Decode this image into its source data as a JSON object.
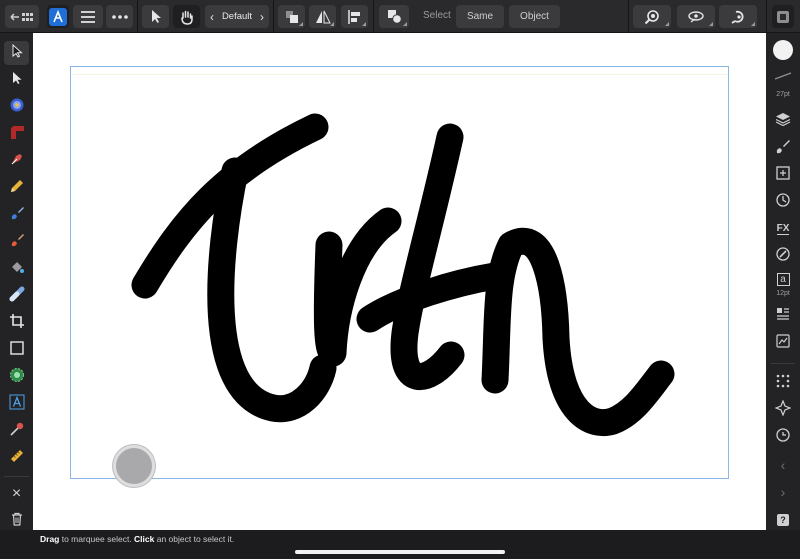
{
  "toolbar": {
    "history_icon": "back-grid-icon",
    "app_icon": "affinity-designer-icon",
    "menu_icon": "hamburger-icon",
    "more_icon": "more-icon",
    "move_icon": "move-tool-icon",
    "hand_icon": "hand-tool-icon",
    "style_prev": "‹",
    "style_name": "Default",
    "style_next": "›",
    "arrange_icon": "arrange-icon",
    "flip_icon": "flip-icon",
    "align_icon": "align-icon",
    "boolean_icon": "boolean-icon",
    "select_label": "Select",
    "same_label": "Same",
    "object_label": "Object",
    "snapping_icon": "snapping-icon",
    "view_icon": "view-quality-icon",
    "assistant_icon": "assistant-icon",
    "export_icon": "export-persona-icon"
  },
  "left_tools": [
    "move-tool-icon",
    "node-tool-icon",
    "gradient-spiral-icon",
    "corner-tool-icon",
    "pen-tool-icon",
    "pencil-tool-icon",
    "vector-brush-icon",
    "pixel-brush-icon",
    "fill-tool-icon",
    "transparency-tool-icon",
    "crop-tool-icon",
    "rectangle-tool-icon",
    "place-image-icon",
    "text-tool-icon",
    "color-picker-icon",
    "measure-tool-icon"
  ],
  "left_bottom": {
    "close_label": "×",
    "delete_icon": "trash-icon"
  },
  "right_panel": {
    "stroke_size": "27pt",
    "text_size": "12pt",
    "text_glyph": "a",
    "fx_label": "FX",
    "help_label": "?",
    "prev_label": "‹",
    "next_label": "›"
  },
  "status": {
    "drag_word": "Drag",
    "drag_rest": " to marquee select. ",
    "click_word": "Click",
    "click_rest": " an object to select it."
  },
  "colors": {
    "toolbar": "#2a2a2c",
    "canvas": "#ffffff",
    "artboard_border": "#8ab8e6",
    "stroke": "#000000",
    "app_accent": "#1f6fd6"
  }
}
